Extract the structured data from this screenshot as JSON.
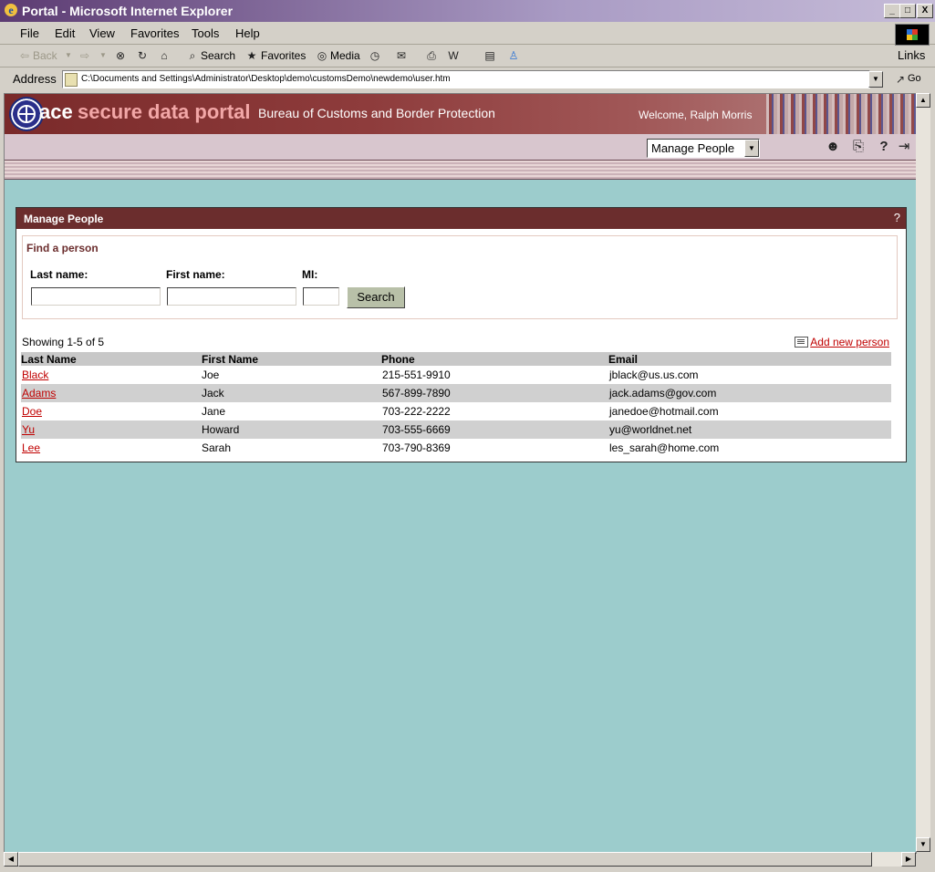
{
  "window": {
    "title": "Portal - Microsoft Internet Explorer",
    "controls": [
      "_",
      "□",
      "X"
    ]
  },
  "menu": [
    "File",
    "Edit",
    "View",
    "Favorites",
    "Tools",
    "Help"
  ],
  "menu_links": "Links",
  "toolbar": {
    "back": "Back",
    "search": "Search",
    "favorites": "Favorites",
    "media": "Media"
  },
  "address": {
    "label": "Address",
    "value": "C:\\Documents and Settings\\Administrator\\Desktop\\demo\\customsDemo\\newdemo\\user.htm",
    "go": "Go"
  },
  "portal": {
    "logo_ace": "ace",
    "logo_rest": "secure data portal",
    "bureau": "Bureau of Customs and Border Protection",
    "welcome": "Welcome, Ralph Morris",
    "nav_select": "Manage People"
  },
  "panel": {
    "title": "Manage People",
    "help": "?",
    "find_title": "Find a person",
    "last_name_label": "Last name:",
    "first_name_label": "First name:",
    "mi_label": "MI:",
    "search_button": "Search",
    "showing": "Showing 1-5 of 5",
    "add_new": "Add new person"
  },
  "table": {
    "headers": [
      "Last Name",
      "First Name",
      "Phone",
      "Email"
    ],
    "rows": [
      [
        "Black",
        "Joe",
        "215-551-9910",
        "jblack@us.us.com"
      ],
      [
        "Adams",
        "Jack",
        "567-899-7890",
        "jack.adams@gov.com"
      ],
      [
        "Doe",
        "Jane",
        "703-222-2222",
        "janedoe@hotmail.com"
      ],
      [
        "Yu",
        "Howard",
        "703-555-6669",
        "yu@worldnet.net"
      ],
      [
        "Lee",
        "Sarah",
        "703-790-8369",
        "les_sarah@home.com"
      ]
    ]
  },
  "colors": {
    "page_bg": "#9ccccc",
    "panel_header": "#6b2d2d",
    "link": "#c00000"
  }
}
